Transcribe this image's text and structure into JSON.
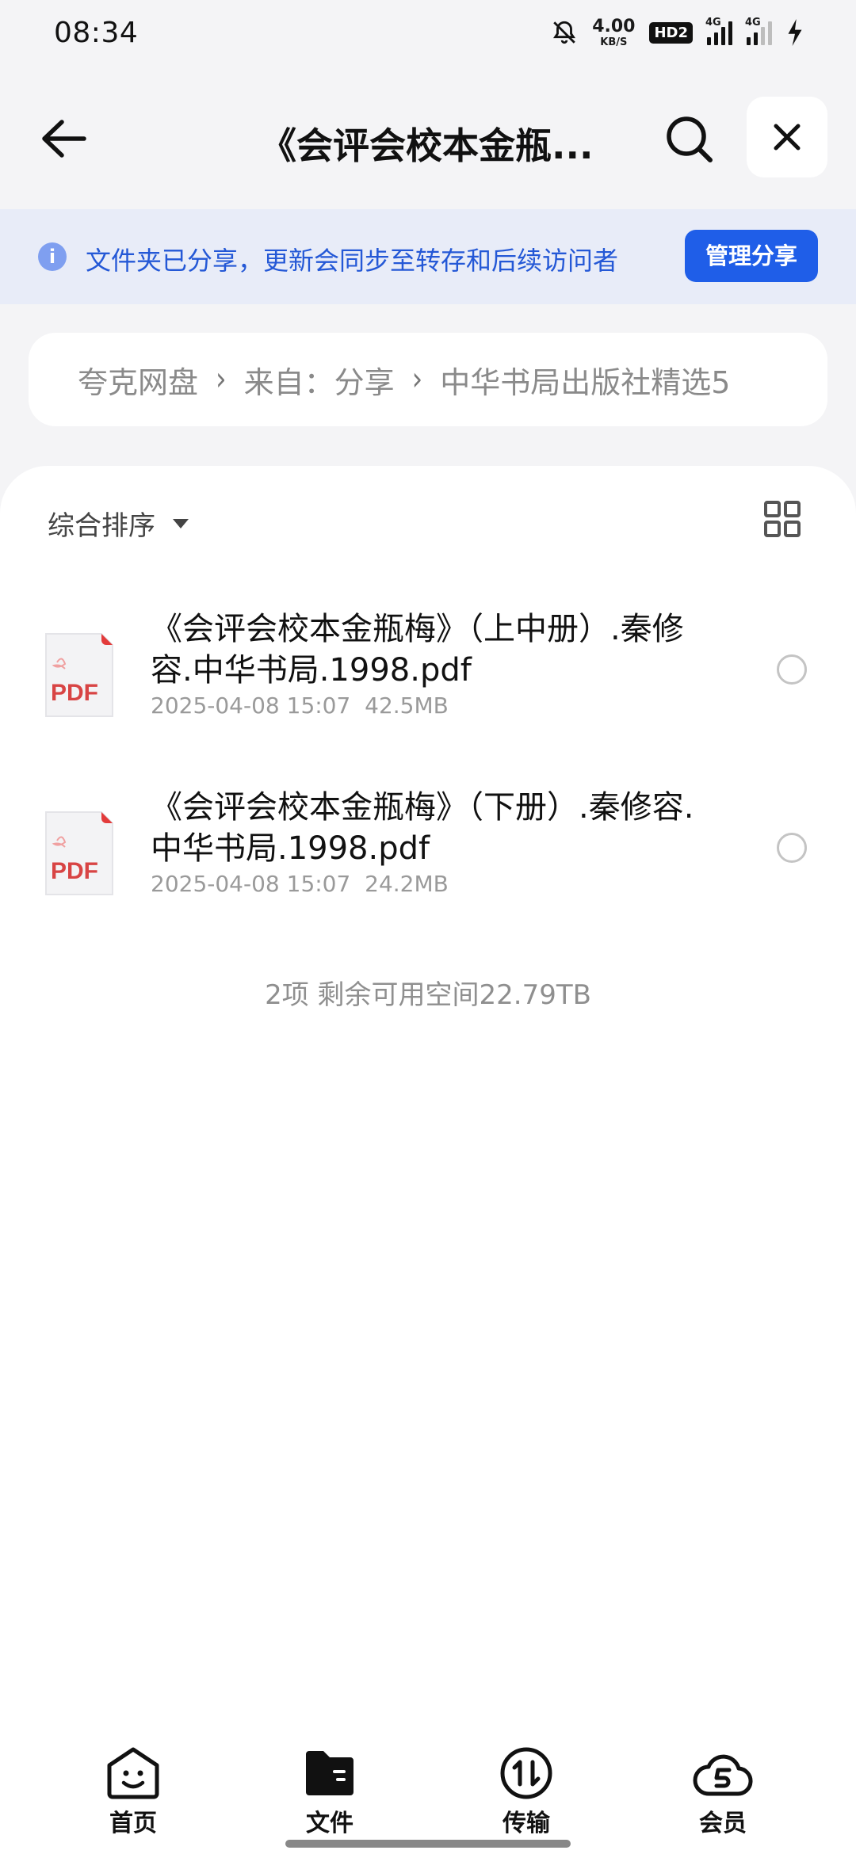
{
  "status_bar": {
    "time": "08:34",
    "speed_value": "4.00",
    "speed_unit": "KB/S",
    "hd_badge": "HD2",
    "signal_1_label": "4G",
    "signal_2_label": "4G",
    "icons": [
      "mute-bell-icon",
      "hd-icon",
      "signal-icon",
      "signal-icon",
      "charging-icon"
    ]
  },
  "header": {
    "title": "《会评会校本金瓶...",
    "icons": [
      "back-arrow-icon",
      "search-icon",
      "close-icon"
    ]
  },
  "share_banner": {
    "text": "文件夹已分享，更新会同步至转存和后续访问者",
    "button_label": "管理分享",
    "accent_color": "#1f5ee8"
  },
  "breadcrumb": {
    "items": [
      "夸克网盘",
      "来自：分享",
      "中华书局出版社精选5"
    ]
  },
  "toolbar": {
    "sort_label": "综合排序",
    "view_toggle_icon": "grid-icon"
  },
  "files": [
    {
      "name": "《会评会校本金瓶梅》（上中册）.秦修容.中华书局.1998.pdf",
      "date": "2025-04-08 15:07",
      "size": "42.5MB",
      "icon_label": "PDF"
    },
    {
      "name": "《会评会校本金瓶梅》（下册）.秦修容.中华书局.1998.pdf",
      "date": "2025-04-08 15:07",
      "size": "24.2MB",
      "icon_label": "PDF"
    }
  ],
  "footer": {
    "summary": "2项 剩余可用空间22.79TB"
  },
  "bottom_nav": {
    "items": [
      {
        "label": "首页",
        "icon": "home-smile-icon"
      },
      {
        "label": "文件",
        "icon": "folder-icon"
      },
      {
        "label": "传输",
        "icon": "transfer-icon"
      },
      {
        "label": "会员",
        "icon": "vip-cloud-icon"
      }
    ],
    "active_index": 1
  }
}
